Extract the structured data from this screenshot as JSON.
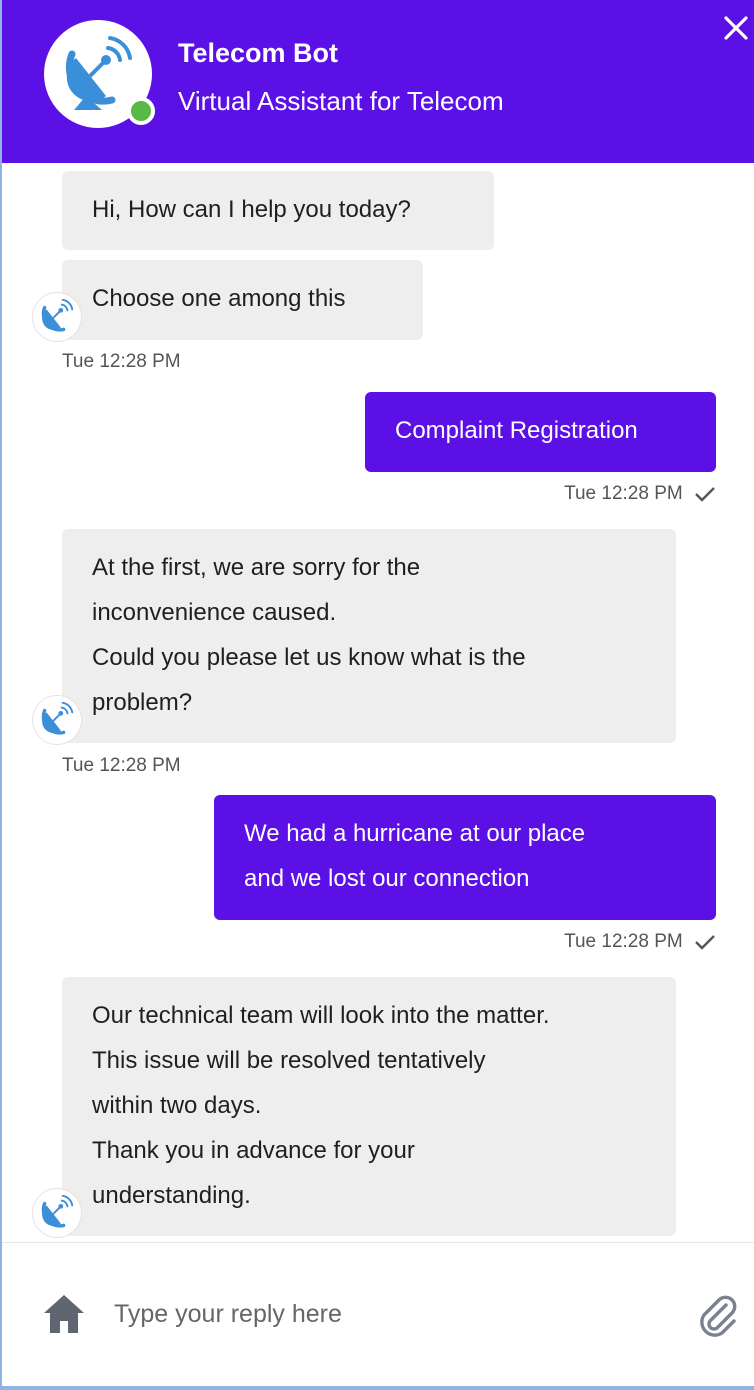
{
  "header": {
    "title": "Telecom Bot",
    "subtitle": "Virtual Assistant for Telecom",
    "avatar_icon": "satellite-dish-icon",
    "status": "online",
    "status_color": "#58b947",
    "close_icon": "close-icon"
  },
  "colors": {
    "accent": "#5b10e6",
    "bot_bubble": "#eeeeee"
  },
  "messages": [
    {
      "sender": "bot",
      "lines": [
        "Hi, How can I help you today?"
      ]
    },
    {
      "sender": "bot",
      "lines": [
        "Choose one among this"
      ],
      "time": "Tue 12:28 PM"
    },
    {
      "sender": "user",
      "lines": [
        "Complaint Registration"
      ],
      "time": "Tue 12:28 PM",
      "delivered": true
    },
    {
      "sender": "bot",
      "lines": [
        "At the first, we are sorry for the",
        "inconvenience caused.",
        "Could you please let us know what is the",
        "problem?"
      ],
      "time": "Tue 12:28 PM"
    },
    {
      "sender": "user",
      "lines": [
        "We had a hurricane at our place",
        "and we lost our connection"
      ],
      "time": "Tue 12:28 PM",
      "delivered": true
    },
    {
      "sender": "bot",
      "lines": [
        "Our technical team will look into the matter.",
        "This issue will be resolved tentatively",
        "within two days.",
        "Thank you in advance for your",
        "understanding."
      ]
    }
  ],
  "composer": {
    "placeholder": "Type your reply here",
    "home_icon": "home-icon",
    "attach_icon": "paperclip-icon"
  }
}
